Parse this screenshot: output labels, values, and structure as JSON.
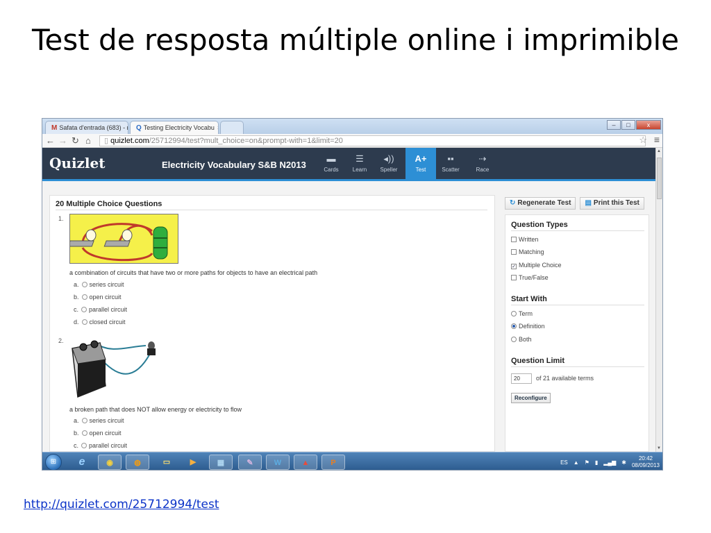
{
  "slide": {
    "title": "Test de resposta múltiple online i imprimible",
    "link": "http://quizlet.com/25712994/test"
  },
  "browser": {
    "tabs": [
      {
        "label": "Safata d'entrada (683) - m",
        "icon": "gmail-icon"
      },
      {
        "label": "Testing Electricity Vocabu",
        "icon": "quizlet-icon"
      },
      {
        "label": ""
      }
    ],
    "url_host": "quizlet.com",
    "url_path": "/25712994/test?mult_choice=on&prompt-with=1&limit=20"
  },
  "quizlet": {
    "logo": "Quizlet",
    "set_title": "Electricity Vocabulary S&B N2013",
    "modes": [
      {
        "label": "Cards",
        "icon": "cards-icon",
        "glyph": "▬"
      },
      {
        "label": "Learn",
        "icon": "learn-icon",
        "glyph": "☰"
      },
      {
        "label": "Speller",
        "icon": "speaker-icon",
        "glyph": "◂))"
      },
      {
        "label": "Test",
        "icon": "test-icon",
        "glyph": "A+",
        "active": true
      },
      {
        "label": "Scatter",
        "icon": "scatter-icon",
        "glyph": "▪▪"
      },
      {
        "label": "Race",
        "icon": "race-icon",
        "glyph": "⇢"
      }
    ]
  },
  "test": {
    "section_title": "20 Multiple Choice Questions",
    "questions": [
      {
        "number": "1.",
        "text": "a combination of circuits that have two or more paths for objects to have an electrical path",
        "options": [
          {
            "letter": "a.",
            "label": "series circuit"
          },
          {
            "letter": "b.",
            "label": "open circuit"
          },
          {
            "letter": "c.",
            "label": "parallel circuit"
          },
          {
            "letter": "d.",
            "label": "closed circuit"
          }
        ]
      },
      {
        "number": "2.",
        "text": "a broken path that does NOT allow energy or electricity to flow",
        "options": [
          {
            "letter": "a.",
            "label": "series circuit"
          },
          {
            "letter": "b.",
            "label": "open circuit"
          },
          {
            "letter": "c.",
            "label": "parallel circuit"
          }
        ]
      }
    ]
  },
  "side": {
    "regenerate_label": "Regenerate Test",
    "print_label": "Print this Test",
    "question_types_title": "Question Types",
    "question_types": [
      {
        "label": "Written",
        "checked": false
      },
      {
        "label": "Matching",
        "checked": false
      },
      {
        "label": "Multiple Choice",
        "checked": true
      },
      {
        "label": "True/False",
        "checked": false
      }
    ],
    "start_with_title": "Start With",
    "start_with": [
      {
        "label": "Term",
        "selected": false
      },
      {
        "label": "Definition",
        "selected": true
      },
      {
        "label": "Both",
        "selected": false
      }
    ],
    "question_limit_title": "Question Limit",
    "limit_value": "20",
    "limit_suffix": "of 21 available terms",
    "reconfigure_label": "Reconfigure"
  },
  "taskbar": {
    "language": "ES",
    "time": "20:42",
    "date": "08/09/2013"
  },
  "colors": {
    "quizlet_header": "#2d3b4e",
    "quizlet_accent": "#2d8fd5",
    "link": "#0b33c8"
  }
}
